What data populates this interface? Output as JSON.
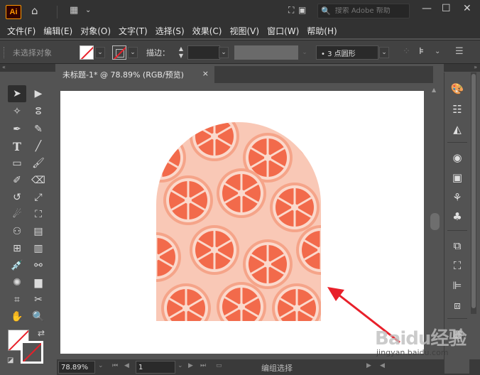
{
  "app": {
    "logo_text": "Ai",
    "search_placeholder": "搜索 Adobe 帮助"
  },
  "menu": [
    "文件(F)",
    "编辑(E)",
    "对象(O)",
    "文字(T)",
    "选择(S)",
    "效果(C)",
    "视图(V)",
    "窗口(W)",
    "帮助(H)"
  ],
  "control_bar": {
    "selection_label": "未选择对象",
    "stroke_label": "描边：",
    "brush_value": "•   3 点圆形"
  },
  "document": {
    "tab_title": "未标题-1* @ 78.89% (RGB/预览)",
    "close_glyph": "×"
  },
  "status": {
    "zoom": "78.89%",
    "page": "1",
    "status_text": "编组选择"
  },
  "watermark": {
    "main": "Baidu经验",
    "sub": "jingyan.baidu.com"
  },
  "colors": {
    "accent_red": "#e8202a",
    "arrow_red": "#e8202a",
    "pattern_bg": "#f9c8b6",
    "orange_rind": "#f07a5a",
    "orange_flesh": "#f26a4b"
  },
  "icons": {
    "home": "home-icon",
    "workspace": "workspace-switcher-icon",
    "search": "search-icon"
  }
}
